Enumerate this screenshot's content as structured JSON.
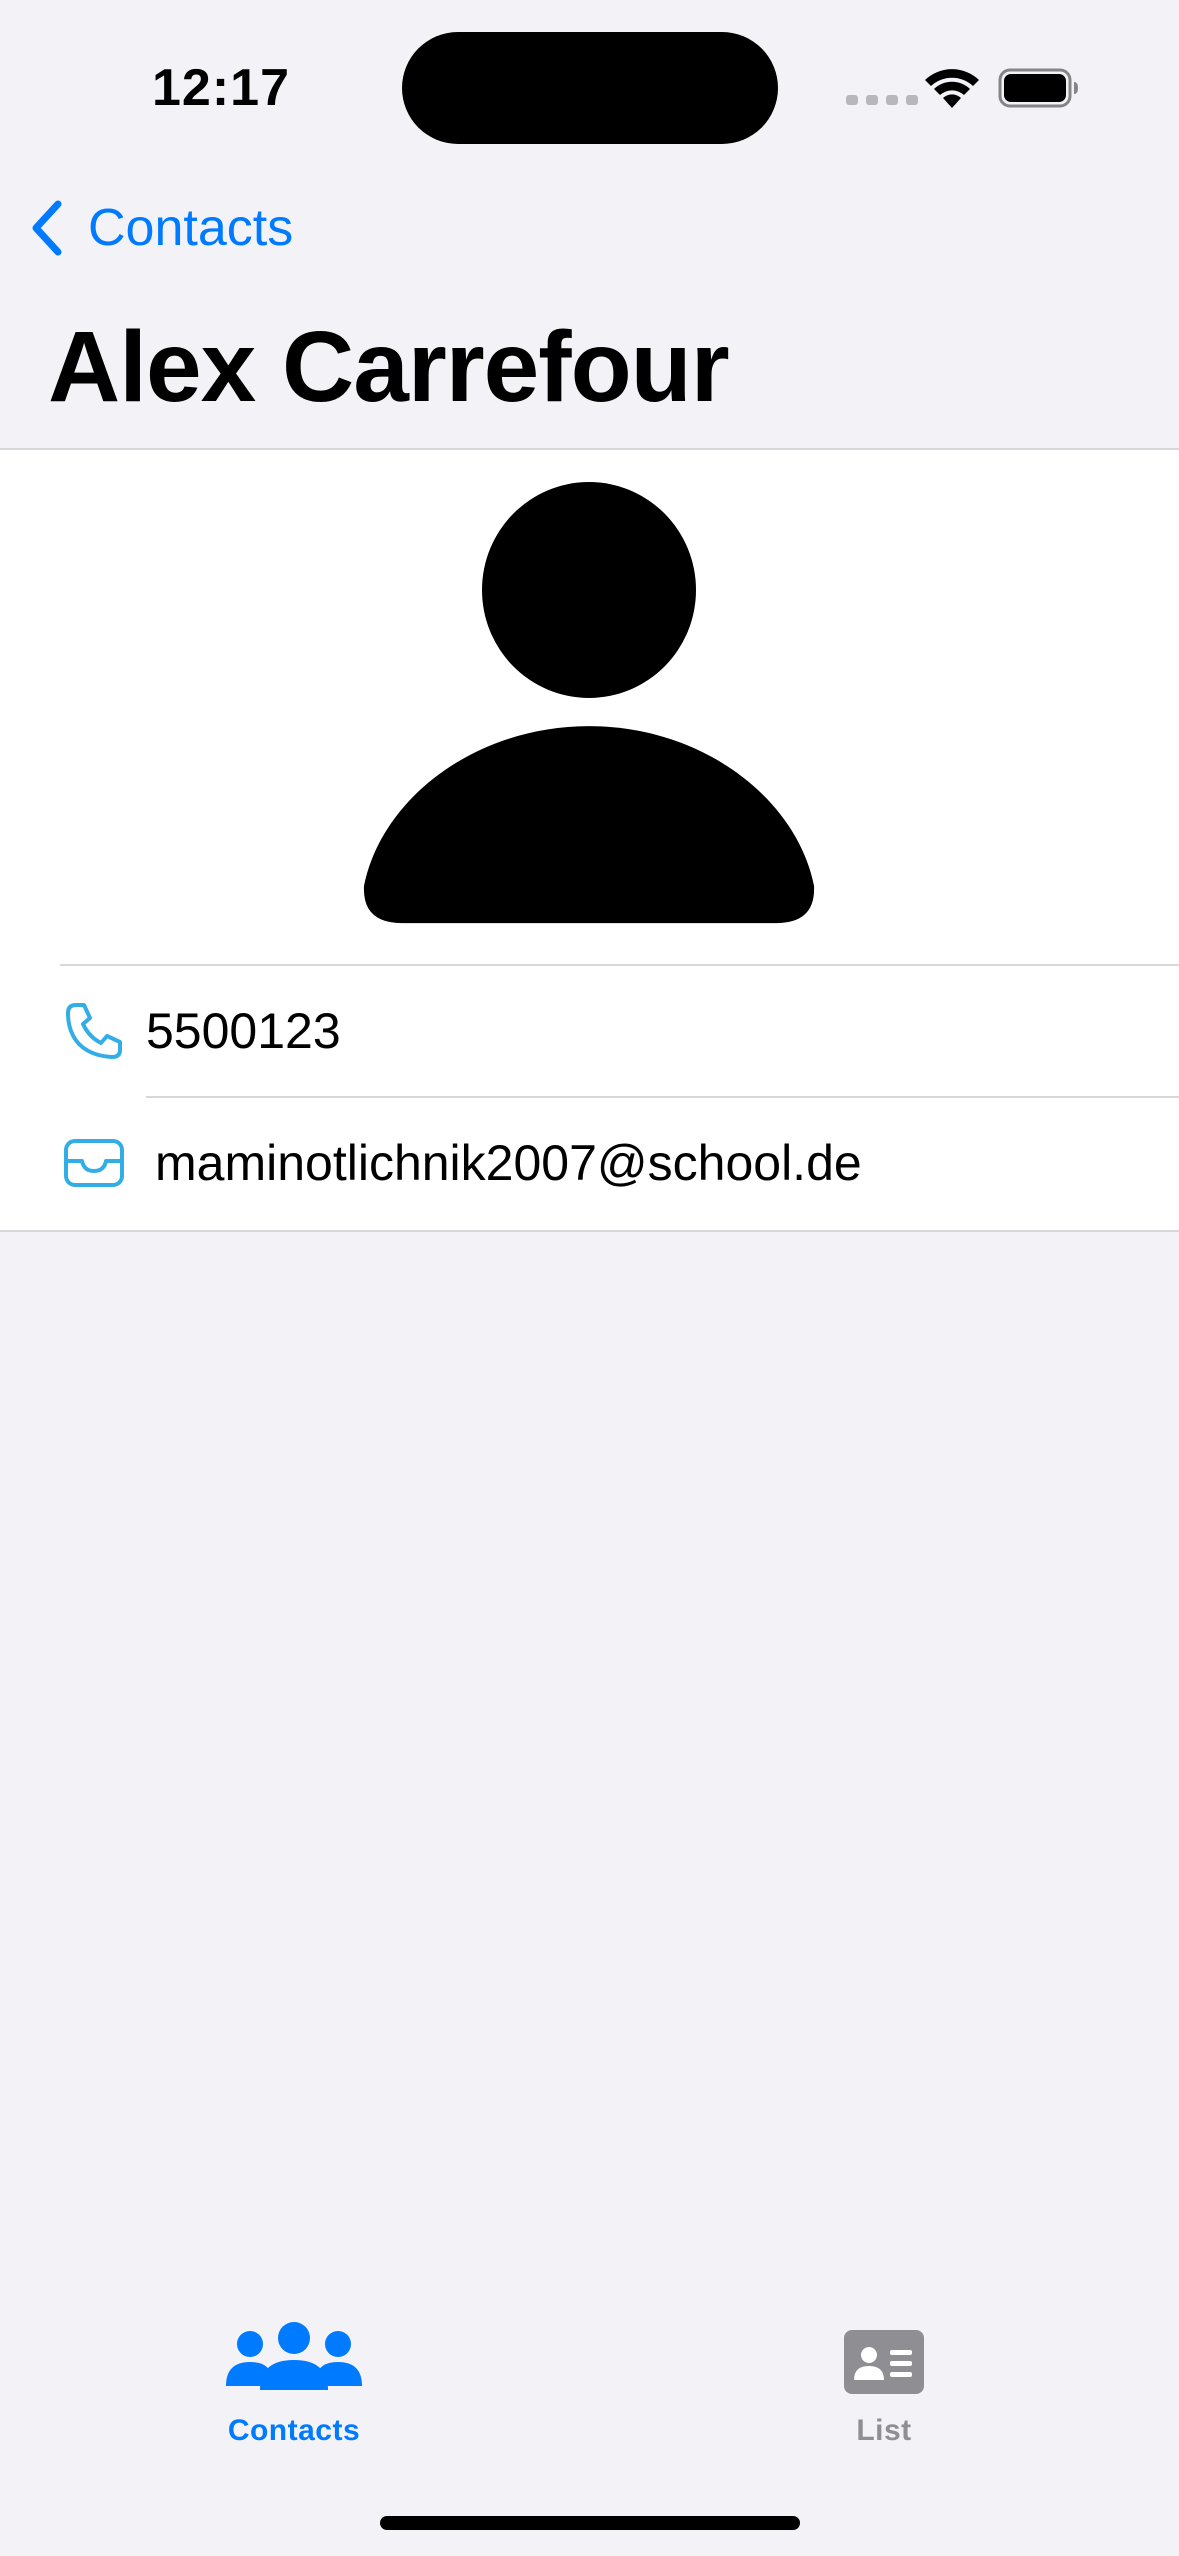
{
  "status_bar": {
    "time": "12:17"
  },
  "nav": {
    "back_label": "Contacts",
    "title": "Alex Carrefour"
  },
  "contact": {
    "phone": "5500123",
    "email": "maminotlichnik2007@school.de"
  },
  "tab_bar": {
    "tabs": [
      {
        "label": "Contacts",
        "icon": "person-3-fill-icon",
        "selected": true
      },
      {
        "label": "List",
        "icon": "person-text-rectangle-fill-icon",
        "selected": false
      }
    ]
  },
  "colors": {
    "accent": "#007aff",
    "row_icon": "#32ade6",
    "background": "#f2f2f7",
    "inactive_tab": "#8e8e93"
  }
}
